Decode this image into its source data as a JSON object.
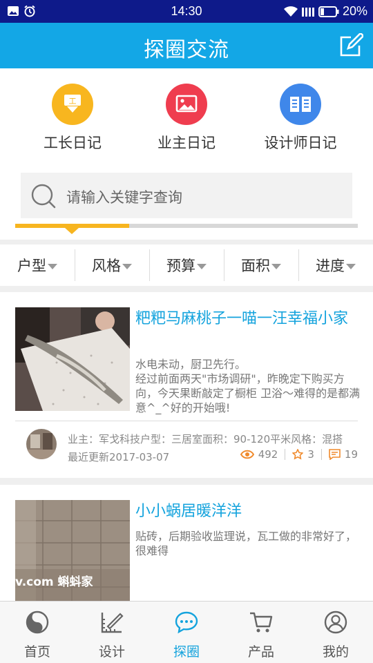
{
  "status_bar": {
    "time": "14:30",
    "battery": "20%"
  },
  "header": {
    "title": "探圈交流"
  },
  "diaries": [
    {
      "label": "工长日记",
      "color": "#f8b61f",
      "icon": "foreman-diary-icon",
      "glyph": "工"
    },
    {
      "label": "业主日记",
      "color": "#ef3d4f",
      "icon": "owner-diary-icon"
    },
    {
      "label": "设计师日记",
      "color": "#3f87ea",
      "icon": "designer-diary-icon"
    }
  ],
  "search": {
    "placeholder": "请输入关键字查询"
  },
  "filters": [
    "户型",
    "风格",
    "预算",
    "面积",
    "进度"
  ],
  "posts": [
    {
      "title": "粑粑马麻桃子一喵一汪幸福小家",
      "desc": "水电未动，厨卫先行。\n经过前面两天\"市场调研\"，昨晚定下购买方向，今天果断敲定了橱柜 卫浴～难得的是都满意^_^好的开始哦!",
      "meta": "业主：军戈科技户型：三居室面积：90-120平米风格：混搭",
      "updated": "最近更新2017-03-07",
      "views": "492",
      "favorites": "3",
      "comments": "19"
    },
    {
      "title": "小小蜗居暖洋洋",
      "desc": "贴砖，后期验收监理说，瓦工做的非常好了，很难得",
      "watermark": "v.com 蝌蚪家"
    }
  ],
  "bottom_nav": [
    {
      "label": "首页",
      "icon": "home-icon"
    },
    {
      "label": "设计",
      "icon": "design-icon"
    },
    {
      "label": "探圈",
      "icon": "community-icon",
      "active": true
    },
    {
      "label": "产品",
      "icon": "cart-icon"
    },
    {
      "label": "我的",
      "icon": "profile-icon"
    }
  ],
  "colors": {
    "brand": "#13a7e6",
    "accent": "#f7b520",
    "title_blue": "#14a3dd"
  }
}
